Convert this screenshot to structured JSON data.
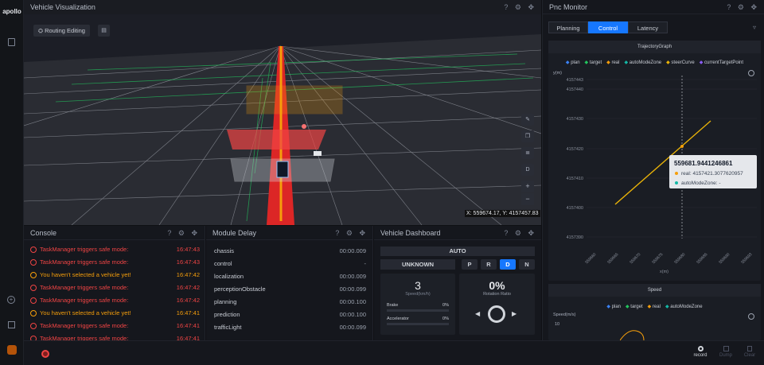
{
  "app": {
    "logo": "apollo"
  },
  "viz": {
    "title": "Vehicle Visualization",
    "routing_label": "Routing Editing",
    "coords": "X: 559674.17, Y: 4157457.83",
    "side_tools": [
      "ruler-icon",
      "copy-icon",
      "layers-icon",
      "D",
      "+",
      "−"
    ]
  },
  "console": {
    "title": "Console",
    "rows": [
      {
        "type": "error",
        "msg": "TaskManager triggers safe mode:",
        "time": "16:47:43"
      },
      {
        "type": "error",
        "msg": "TaskManager triggers safe mode:",
        "time": "16:47:43"
      },
      {
        "type": "warn",
        "msg": "You haven't selected a vehicle yet!",
        "time": "16:47:42"
      },
      {
        "type": "error",
        "msg": "TaskManager triggers safe mode:",
        "time": "16:47:42"
      },
      {
        "type": "error",
        "msg": "TaskManager triggers safe mode:",
        "time": "16:47:42"
      },
      {
        "type": "warn",
        "msg": "You haven't selected a vehicle yet!",
        "time": "16:47:41"
      },
      {
        "type": "error",
        "msg": "TaskManager triggers safe mode:",
        "time": "16:47:41"
      },
      {
        "type": "error",
        "msg": "TaskManager triggers safe mode:",
        "time": "16:47:41"
      }
    ]
  },
  "delay": {
    "title": "Module Delay",
    "rows": [
      {
        "name": "chassis",
        "value": "00:00.009"
      },
      {
        "name": "control",
        "value": "-"
      },
      {
        "name": "localization",
        "value": "00:00.009"
      },
      {
        "name": "perceptionObstacle",
        "value": "00:00.099"
      },
      {
        "name": "planning",
        "value": "00:00.100"
      },
      {
        "name": "prediction",
        "value": "00:00.100"
      },
      {
        "name": "trafficLight",
        "value": "00:00.099"
      }
    ]
  },
  "dash": {
    "title": "Vehicle Dashboard",
    "mode": "AUTO",
    "status": "UNKNOWN",
    "gears": [
      "P",
      "R",
      "D",
      "N"
    ],
    "active_gear": "D",
    "speed": "3",
    "speed_unit": "Speed(km/h)",
    "brake_label": "Brake",
    "brake_value": "0%",
    "brake_level": 0,
    "accel_label": "Accelerator",
    "accel_value": "0%",
    "accel_level": 0,
    "rotation": "0%",
    "rotation_label": "Rotation Ratio"
  },
  "pnc": {
    "title": "Pnc Monitor",
    "tabs": [
      "Planning",
      "Control",
      "Latency"
    ],
    "active_tab": "Control",
    "traj": {
      "title": "TrajectoryGraph",
      "legend": [
        {
          "name": "plan",
          "color": "#3b82f6"
        },
        {
          "name": "target",
          "color": "#22c55e"
        },
        {
          "name": "real",
          "color": "#f59e0b"
        },
        {
          "name": "autoModeZone",
          "color": "#14b8a6"
        },
        {
          "name": "steerCurve",
          "color": "#eab308"
        },
        {
          "name": "currentTargetPoint",
          "color": "#8b5cf6"
        }
      ],
      "ylabel": "y(m)",
      "xlabel": "x(m)",
      "yticks": [
        "4157443",
        "4157440",
        "4157430",
        "4157420",
        "4157410",
        "4157400",
        "4157390"
      ],
      "xticks": [
        "559660",
        "559665",
        "559670",
        "559675",
        "559680",
        "559685",
        "559690",
        "559693"
      ],
      "tooltip": {
        "title": "559681.9441246861",
        "real": "real: 4157421.3077620957",
        "zone": "autoModeZone: -"
      }
    },
    "speed": {
      "title": "Speed",
      "legend": [
        {
          "name": "plan",
          "color": "#3b82f6"
        },
        {
          "name": "target",
          "color": "#22c55e"
        },
        {
          "name": "real",
          "color": "#f59e0b"
        },
        {
          "name": "autoModeZone",
          "color": "#14b8a6"
        }
      ],
      "ylabel": "Speed(m/s)",
      "ytick": "10"
    }
  },
  "bottom": {
    "record": "record",
    "dump": "Dump",
    "clear": "Clear"
  },
  "colors": {
    "accent": "#1677ff",
    "error": "#ef4444",
    "warn": "#f59e0b"
  }
}
